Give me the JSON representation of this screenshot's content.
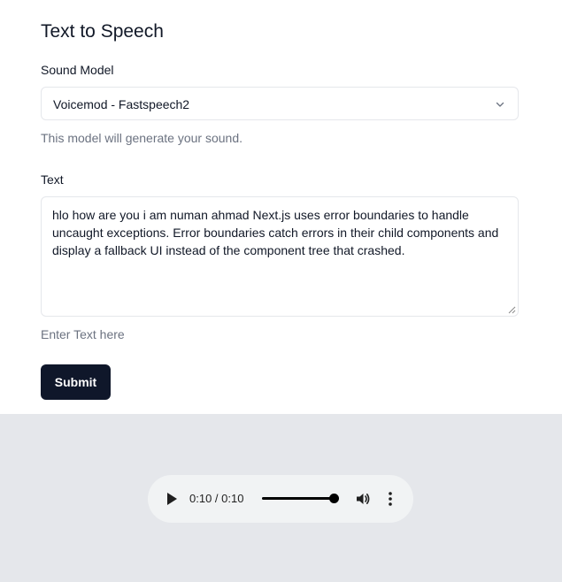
{
  "form": {
    "title": "Text to Speech",
    "model_label": "Sound Model",
    "model_value": "Voicemod - Fastspeech2",
    "model_helper": "This model will generate your sound.",
    "text_label": "Text",
    "text_value": "hlo how are you i am numan ahmad Next.js uses error boundaries to handle uncaught exceptions. Error boundaries catch errors in their child components and display a fallback UI instead of the component tree that crashed.",
    "text_helper": "Enter Text here",
    "submit_label": "Submit"
  },
  "audio_player": {
    "time_display": "0:10 / 0:10",
    "progress_fraction": 1.0,
    "icons": [
      "play-icon",
      "volume-icon",
      "more-vertical-icon"
    ]
  },
  "colors": {
    "button_bg": "#0f172a",
    "audio_area_bg": "#e5e7eb",
    "player_bg": "#f1f3f4",
    "helper_text": "#6b7280"
  }
}
